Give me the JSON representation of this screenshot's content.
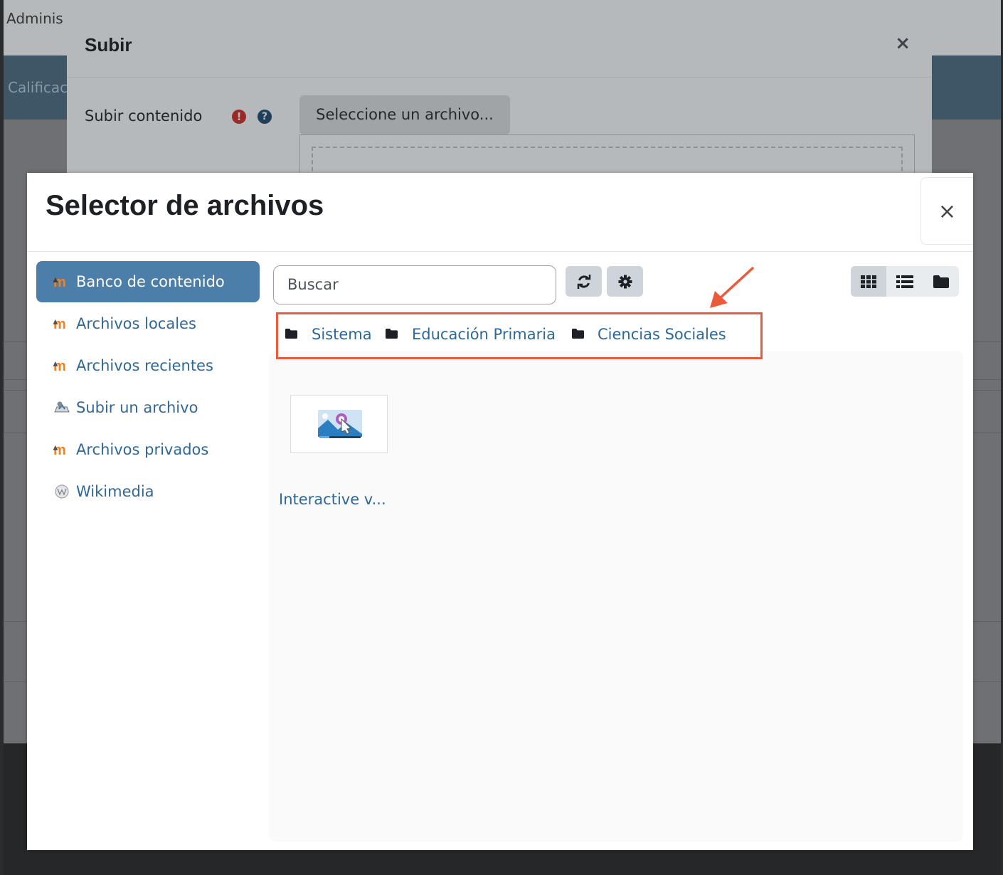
{
  "background": {
    "topbar_text": "Adminis",
    "navbar_text": "Calificac"
  },
  "upload_modal": {
    "title": "Subir",
    "close": "×",
    "field_label": "Subir contenido",
    "required_icon": "exclamation-circle-icon",
    "help_icon": "question-circle-icon",
    "choose_button": "Seleccione un archivo..."
  },
  "picker": {
    "title": "Selector de archivos",
    "close": "×",
    "nav": [
      {
        "label": "Banco de contenido",
        "icon": "moodle-icon",
        "active": true
      },
      {
        "label": "Archivos locales",
        "icon": "moodle-icon",
        "active": false
      },
      {
        "label": "Archivos recientes",
        "icon": "moodle-icon",
        "active": false
      },
      {
        "label": "Subir un archivo",
        "icon": "upload-icon",
        "active": false
      },
      {
        "label": "Archivos privados",
        "icon": "moodle-icon",
        "active": false
      },
      {
        "label": "Wikimedia",
        "icon": "wikimedia-icon",
        "active": false
      }
    ],
    "search": {
      "placeholder": "Buscar"
    },
    "toolbar": {
      "refresh_icon": "refresh-icon",
      "settings_icon": "gear-icon"
    },
    "views": [
      {
        "icon": "grid-icon",
        "active": true
      },
      {
        "icon": "list-icon",
        "active": false
      },
      {
        "icon": "folder-icon",
        "active": false
      }
    ],
    "breadcrumb": [
      "Sistema",
      "Educación Primaria",
      "Ciencias Sociales"
    ],
    "files": [
      {
        "name": "Interactive v...",
        "icon": "interactive-video-icon"
      }
    ]
  },
  "annotation": {
    "color": "#ec5a3c"
  }
}
